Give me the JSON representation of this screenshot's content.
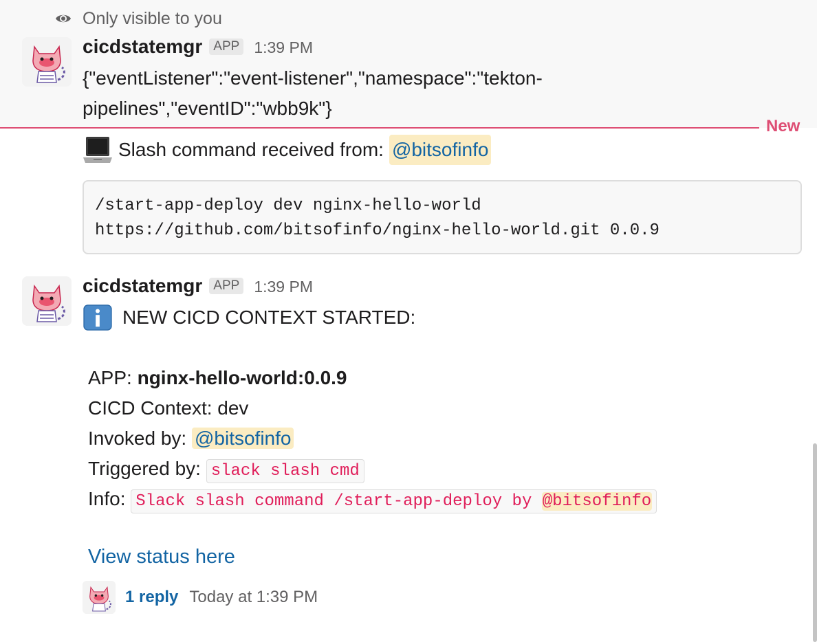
{
  "ephemeral": {
    "visibility_note": "Only visible to you",
    "sender": "cicdstatemgr",
    "badge": "APP",
    "time": "1:39 PM",
    "text_line1": "{\"eventListener\":\"event-listener\",\"namespace\":\"tekton-",
    "text_line2": "pipelines\",\"eventID\":\"wbb9k\"}"
  },
  "divider": {
    "label": "New"
  },
  "slash_message": {
    "emoji": "laptop-icon",
    "text": "Slash command received from:",
    "mention": "@bitsofinfo",
    "code_line1": "/start-app-deploy dev nginx-hello-world",
    "code_line2": "https://github.com/bitsofinfo/nginx-hello-world.git 0.0.9"
  },
  "context_message": {
    "sender": "cicdstatemgr",
    "badge": "APP",
    "time": "1:39 PM",
    "heading": "NEW CICD CONTEXT STARTED:",
    "app_label": "APP:",
    "app_value": "nginx-hello-world:0.0.9",
    "context_label": "CICD Context:",
    "context_value": "dev",
    "invoked_label": "Invoked by:",
    "invoked_value": "@bitsofinfo",
    "triggered_label": "Triggered by:",
    "triggered_value": "slack slash cmd",
    "info_label": "Info:",
    "info_value": "Slack slash command /start-app-deploy by",
    "info_mention": "@bitsofinfo",
    "link": "View status here",
    "reply_count": "1 reply",
    "reply_time": "Today at 1:39 PM"
  },
  "colors": {
    "mention_bg": "#fbecc2",
    "link": "#1264a3",
    "new_divider": "#de4e74",
    "inline_code": "#e01e5a"
  }
}
